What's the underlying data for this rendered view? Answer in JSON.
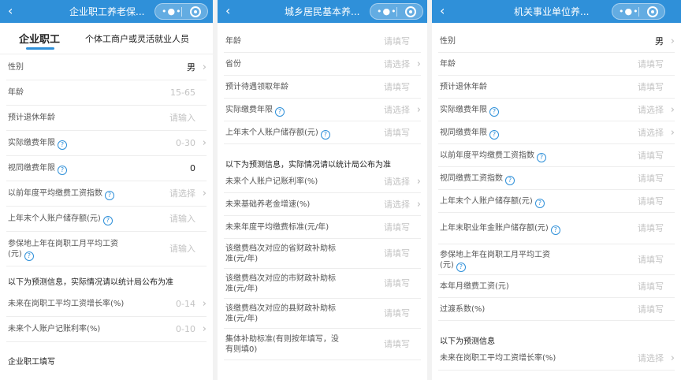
{
  "panel1": {
    "title": "企业职工养老保...",
    "back": "‹",
    "capsule_more": "•●•",
    "tabs": [
      "企业职工",
      "个体工商户或灵活就业人员"
    ],
    "rows": [
      {
        "label": "性别",
        "value": "男"
      },
      {
        "label": "年龄",
        "value": "15-65"
      },
      {
        "label": "预计退休年龄",
        "value": "请输入"
      },
      {
        "label": "实际缴费年限",
        "value": "0-30"
      },
      {
        "label": "视同缴费年限",
        "value": "0"
      },
      {
        "label": "以前年度平均缴费工资指数",
        "value": "请选择"
      },
      {
        "label": "上年末个人账户储存额(元)",
        "value": "请输入"
      },
      {
        "label": "参保地上年在岗职工月平均工资",
        "label2": "(元)",
        "value": "请输入"
      }
    ],
    "section": "以下为预测信息，实际情况请以统计局公布为准",
    "rows2": [
      {
        "label": "未来在岗职工平均工资增长率(%)",
        "value": "0-14"
      },
      {
        "label": "未来个人账户记账利率(%)",
        "value": "0-10"
      }
    ],
    "footer": "企业职工填写"
  },
  "panel2": {
    "title": "城乡居民基本养...",
    "back": "‹",
    "capsule_more": "•●•",
    "rows": [
      {
        "label": "年龄",
        "value": "请填写"
      },
      {
        "label": "省份",
        "value": "请选择"
      },
      {
        "label": "预计待遇领取年龄",
        "value": "请填写"
      },
      {
        "label": "实际缴费年限",
        "value": "请选择"
      },
      {
        "label": "上年末个人账户储存额(元)",
        "value": "请填写"
      }
    ],
    "section": "以下为预测信息，实际情况请以统计局公布为准",
    "rows2": [
      {
        "label": "未来个人账户记账利率(%)",
        "value": "请选择"
      },
      {
        "label": "未来基础养老金增速(%)",
        "value": "请选择"
      },
      {
        "label": "未来年度平均缴费标准(元/年)",
        "value": "请填写"
      },
      {
        "label": "该缴费档次对应的省财政补助标",
        "label2": "准(元/年)",
        "value": "请填写"
      },
      {
        "label": "该缴费档次对应的市财政补助标",
        "label2": "准(元/年)",
        "value": "请填写"
      },
      {
        "label": "该缴费档次对应的县财政补助标",
        "label2": "准(元/年)",
        "value": "请填写"
      },
      {
        "label": "集体补助标准(有则按年填写，没",
        "label2": "有则填0)",
        "value": "请填写"
      }
    ]
  },
  "panel3": {
    "title": "机关事业单位养...",
    "back": "‹",
    "capsule_more": "•●•",
    "rows": [
      {
        "label": "性别",
        "value": "男"
      },
      {
        "label": "年龄",
        "value": "请填写"
      },
      {
        "label": "预计退休年龄",
        "value": "请填写"
      },
      {
        "label": "实际缴费年限",
        "value": "请选择"
      },
      {
        "label": "视同缴费年限",
        "value": "请选择"
      },
      {
        "label": "以前年度平均缴费工资指数",
        "value": "请填写"
      },
      {
        "label": "视同缴费工资指数",
        "value": "请填写"
      },
      {
        "label": "上年末个人账户储存额(元)",
        "value": "请填写"
      },
      {
        "label": "上年末职业年金账户储存额(元)",
        "value": "请填写"
      },
      {
        "label": "参保地上年在岗职工月平均工资",
        "label2": "(元)",
        "value": "请填写"
      },
      {
        "label": "本年月缴费工资(元)",
        "value": "请填写"
      },
      {
        "label": "过渡系数(%)",
        "value": "请填写"
      }
    ],
    "section": "以下为预测信息",
    "rows2": [
      {
        "label": "未来在岗职工平均工资增长率(%)",
        "value": "请选择"
      }
    ]
  },
  "colors": {
    "header": "#2f90d9",
    "placeholder": "#c3c3c3",
    "label": "#555555",
    "help_icon": "#2f90d9"
  },
  "icons": {
    "back": "chevron-left-icon",
    "more": "more-dots-icon",
    "close": "capsule-close-icon",
    "help": "question-circle-icon",
    "chevron": "chevron-right-icon"
  }
}
